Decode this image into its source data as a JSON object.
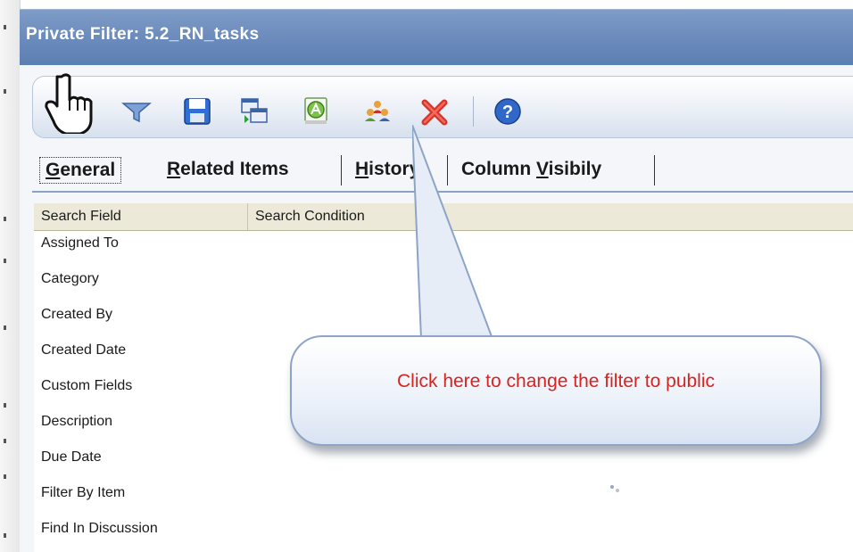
{
  "window": {
    "title": "Private Filter: 5.2_RN_tasks"
  },
  "toolbar": {
    "icons": [
      "hand-pointer-icon",
      "filter-funnel-icon",
      "save-floppy-icon",
      "copy-windows-icon",
      "rename-a-icon",
      "public-users-icon",
      "delete-x-icon",
      "help-question-icon"
    ]
  },
  "tabs": [
    {
      "prefix": "",
      "key": "G",
      "rest": "eneral"
    },
    {
      "prefix": "",
      "key": "R",
      "rest": "elated Items"
    },
    {
      "prefix": "",
      "key": "H",
      "rest": "istory"
    },
    {
      "prefix": "Column ",
      "key": "V",
      "rest": "isibily"
    }
  ],
  "grid": {
    "columns": [
      "Search Field",
      "Search Condition"
    ],
    "rows": [
      "Assigned To",
      "Category",
      "Created By",
      "Created Date",
      "Custom Fields",
      "Description",
      "Due Date",
      "Filter By Item",
      "Find In Discussion"
    ]
  },
  "callout": {
    "text": "Click here to change the filter to public"
  },
  "colors": {
    "title_bar": "#6d8dbd",
    "callout_text": "#d9231f",
    "grid_header": "#ece9d8"
  }
}
